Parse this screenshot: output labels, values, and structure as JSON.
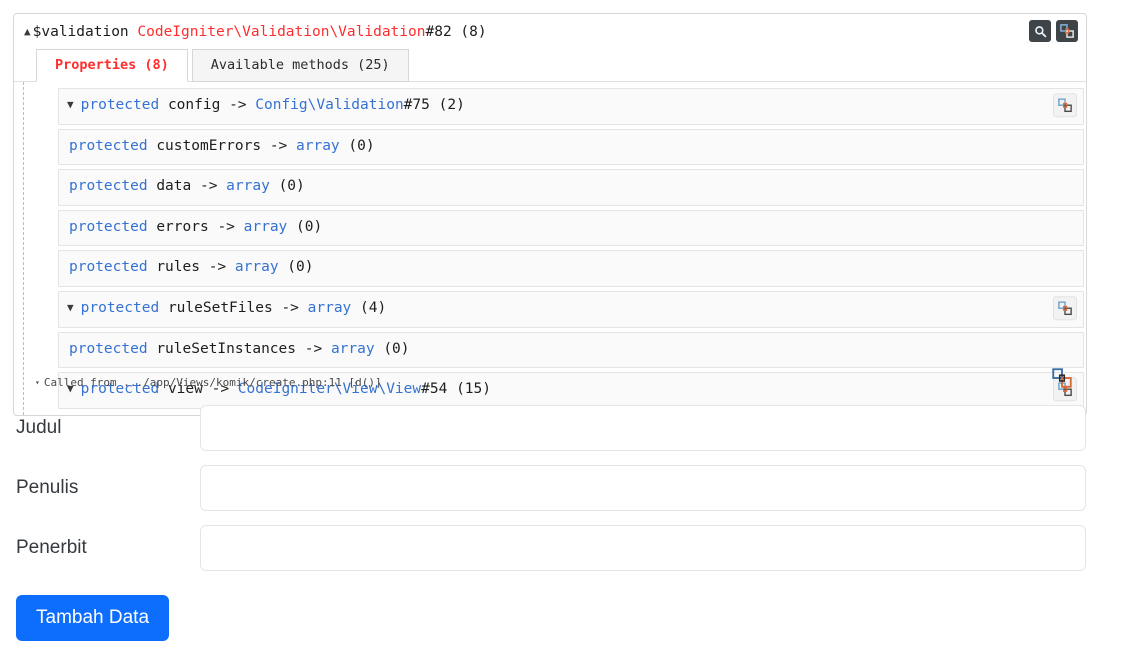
{
  "debug_panel": {
    "header": {
      "caret": "▲",
      "var_name": "$validation",
      "class_path": "CodeIgniter\\Validation\\Validation",
      "object_id": "#82",
      "count": "(8)",
      "icons": [
        {
          "name": "search-icon",
          "glyph": "search"
        },
        {
          "name": "expand-all-icon",
          "glyph": "expand"
        }
      ]
    },
    "tabs": [
      {
        "label": "Properties (8)",
        "active": true
      },
      {
        "label": "Available methods (25)",
        "active": false
      }
    ],
    "properties": [
      {
        "expandable": true,
        "caret": "▼",
        "modifier": "protected",
        "name": "config",
        "arrow": "->",
        "type": "Config\\Validation",
        "object_id": "#75",
        "count": "(2)",
        "has_icon": true
      },
      {
        "expandable": false,
        "caret": "",
        "modifier": "protected",
        "name": "customErrors",
        "arrow": "->",
        "type": "array",
        "object_id": "",
        "count": "(0)",
        "has_icon": false
      },
      {
        "expandable": false,
        "caret": "",
        "modifier": "protected",
        "name": "data",
        "arrow": "->",
        "type": "array",
        "object_id": "",
        "count": "(0)",
        "has_icon": false
      },
      {
        "expandable": false,
        "caret": "",
        "modifier": "protected",
        "name": "errors",
        "arrow": "->",
        "type": "array",
        "object_id": "",
        "count": "(0)",
        "has_icon": false
      },
      {
        "expandable": false,
        "caret": "",
        "modifier": "protected",
        "name": "rules",
        "arrow": "->",
        "type": "array",
        "object_id": "",
        "count": "(0)",
        "has_icon": false
      },
      {
        "expandable": true,
        "caret": "▼",
        "modifier": "protected",
        "name": "ruleSetFiles",
        "arrow": "->",
        "type": "array",
        "object_id": "",
        "count": "(4)",
        "has_icon": true
      },
      {
        "expandable": false,
        "caret": "",
        "modifier": "protected",
        "name": "ruleSetInstances",
        "arrow": "->",
        "type": "array",
        "object_id": "",
        "count": "(0)",
        "has_icon": false
      },
      {
        "expandable": true,
        "caret": "▼",
        "modifier": "protected",
        "name": "view",
        "arrow": "->",
        "type": "CodeIgniter\\View\\View",
        "object_id": "#54",
        "count": "(15)",
        "has_icon": true
      }
    ],
    "called_from": {
      "caret": "▾",
      "text": "Called from .../app/Views/komik/create.php:11 [d()]"
    }
  },
  "form": {
    "fields": [
      {
        "label": "Judul",
        "value": "",
        "placeholder": ""
      },
      {
        "label": "Penulis",
        "value": "",
        "placeholder": ""
      },
      {
        "label": "Penerbit",
        "value": "",
        "placeholder": ""
      }
    ],
    "submit_label": "Tambah Data"
  },
  "colors": {
    "accent_blue": "#0d6efd",
    "class_red": "#ff2d2d",
    "keyword_blue": "#3572d3"
  }
}
